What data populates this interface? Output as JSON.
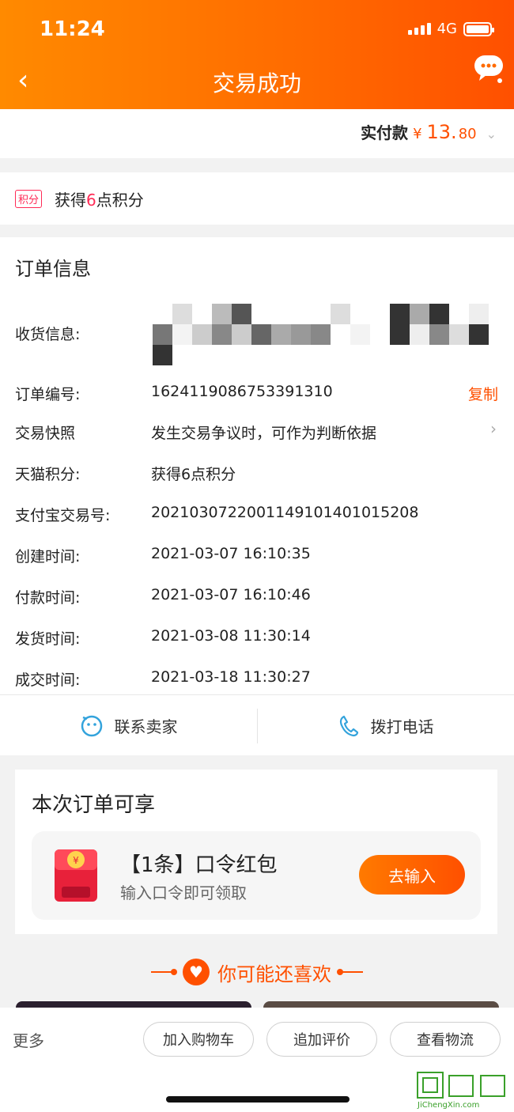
{
  "status_bar": {
    "time": "11:24",
    "network": "4G"
  },
  "header": {
    "title": "交易成功",
    "back_icon": "chevron-left-icon",
    "chat_icon": "chat-bubble-icon"
  },
  "payment": {
    "label": "实付款",
    "currency": "¥",
    "amount_int": "13.",
    "amount_dec": "80"
  },
  "points": {
    "badge": "积分",
    "prefix": "获得",
    "count": "6",
    "suffix": "点积分"
  },
  "order_info": {
    "title": "订单信息",
    "rows": [
      {
        "label": "收货信息:",
        "value": ""
      },
      {
        "label": "订单编号:",
        "value": "1624119086753391310",
        "action": "复制"
      },
      {
        "label": "交易快照",
        "value": "发生交易争议时，可作为判断依据"
      },
      {
        "label": "天猫积分:",
        "value": "获得6点积分"
      },
      {
        "label": "支付宝交易号:",
        "value": "2021030722001149101401015208"
      },
      {
        "label": "创建时间:",
        "value": "2021-03-07 16:10:35"
      },
      {
        "label": "付款时间:",
        "value": "2021-03-07 16:10:46"
      },
      {
        "label": "发货时间:",
        "value": "2021-03-08 11:30:14"
      },
      {
        "label": "成交时间:",
        "value": "2021-03-18 11:30:27"
      }
    ]
  },
  "actions": {
    "contact_seller": "联系卖家",
    "call": "拨打电话"
  },
  "promo": {
    "title": "本次订单可享",
    "main": "【1条】口令红包",
    "sub": "输入口令即可领取",
    "button": "去输入"
  },
  "recommend": {
    "title": "你可能还喜欢"
  },
  "bottom_bar": {
    "more": "更多",
    "add_cart": "加入购物车",
    "review": "追加评价",
    "logistics": "查看物流"
  },
  "watermark": {
    "text": "JiChengXin.com"
  },
  "colors": {
    "accent": "#ff5000",
    "points_red": "#ff2a55",
    "header_start": "#ff8a00"
  }
}
